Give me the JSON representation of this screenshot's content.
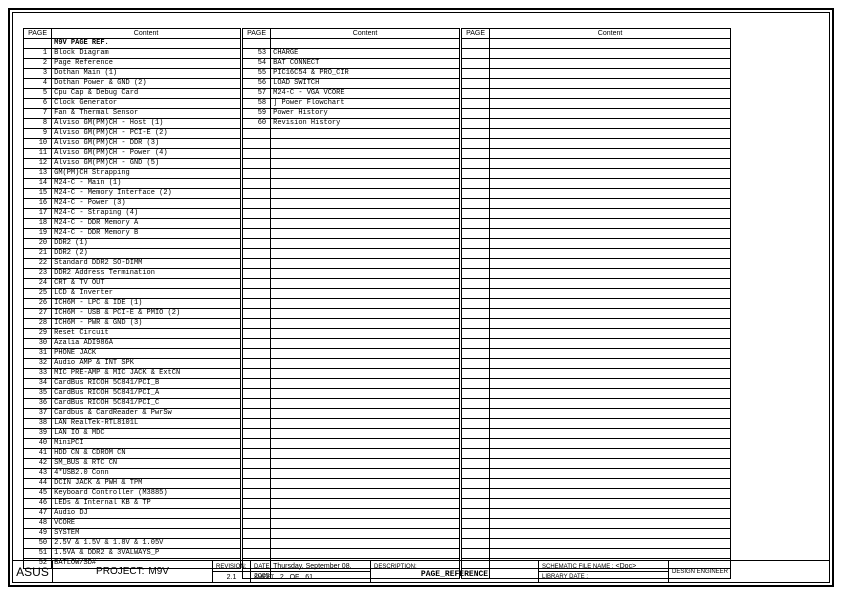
{
  "headers": {
    "page": "PAGE",
    "content": "Content"
  },
  "heading_row": "M9V PAGE REF.",
  "left": [
    {
      "p": "1",
      "c": "Block Diagram"
    },
    {
      "p": "2",
      "c": "Page Reference"
    },
    {
      "p": "3",
      "c": "Dothan Main (1)"
    },
    {
      "p": "4",
      "c": "Dothan Power & GND (2)"
    },
    {
      "p": "5",
      "c": "Cpu Cap & Debug Card"
    },
    {
      "p": "6",
      "c": "Clock Generator"
    },
    {
      "p": "7",
      "c": "Fan & Thermal Sensor"
    },
    {
      "p": "8",
      "c": "Alviso GM(PM)CH - Host (1)"
    },
    {
      "p": "9",
      "c": "Alviso GM(PM)CH - PCI-E (2)"
    },
    {
      "p": "10",
      "c": "Alviso GM(PM)CH - DDR (3)"
    },
    {
      "p": "11",
      "c": "Alviso GM(PM)CH - Power (4)"
    },
    {
      "p": "12",
      "c": "Alviso GM(PM)CH - GND (5)"
    },
    {
      "p": "13",
      "c": "GM(PM)CH Strapping"
    },
    {
      "p": "14",
      "c": "M24-C - Main (1)"
    },
    {
      "p": "15",
      "c": "M24-C - Memory Interface (2)"
    },
    {
      "p": "16",
      "c": "M24-C - Power (3)"
    },
    {
      "p": "17",
      "c": "M24-C - Straping (4)"
    },
    {
      "p": "18",
      "c": "M24-C - DDR Memory A"
    },
    {
      "p": "19",
      "c": "M24-C - DDR Memory B"
    },
    {
      "p": "20",
      "c": "DDR2 (1)"
    },
    {
      "p": "21",
      "c": "DDR2 (2)"
    },
    {
      "p": "22",
      "c": "Standard DDR2 SO-DIMM"
    },
    {
      "p": "23",
      "c": "DDR2 Address Termination"
    },
    {
      "p": "24",
      "c": "CRT & TV OUT"
    },
    {
      "p": "25",
      "c": "LCD & Inverter"
    },
    {
      "p": "26",
      "c": "ICH6M - LPC & IDE (1)"
    },
    {
      "p": "27",
      "c": "ICH6M - USB & PCI-E & PMIO (2)"
    },
    {
      "p": "28",
      "c": "ICH6M - PWR & GND (3)"
    },
    {
      "p": "29",
      "c": "Reset Circuit"
    },
    {
      "p": "30",
      "c": "Azalia ADI986A"
    },
    {
      "p": "31",
      "c": "PHONE JACK"
    },
    {
      "p": "32",
      "c": "Audio AMP & INT SPK"
    },
    {
      "p": "33",
      "c": "MIC PRE-AMP & MIC JACK & ExtCN"
    },
    {
      "p": "34",
      "c": "CardBus RICOH 5C841/PCI_B"
    },
    {
      "p": "35",
      "c": "CardBus RICOH 5C841/PCI_A"
    },
    {
      "p": "36",
      "c": "CardBus RICOH 5C841/PCI_C"
    },
    {
      "p": "37",
      "c": "Cardbus & CardReader & PwrSw"
    },
    {
      "p": "38",
      "c": "LAN RealTek-RTL8101L"
    },
    {
      "p": "39",
      "c": "LAN IO & MDC"
    },
    {
      "p": "40",
      "c": "MiniPCI"
    },
    {
      "p": "41",
      "c": "HDD CN & CDROM CN"
    },
    {
      "p": "42",
      "c": "SM_BUS & RTC CN"
    },
    {
      "p": "43",
      "c": "4*USB2.0 Conn"
    },
    {
      "p": "44",
      "c": "DCIN JACK & PWH & TPM"
    },
    {
      "p": "45",
      "c": "Keyboard Controller (M3885)"
    },
    {
      "p": "46",
      "c": "LEDs & Internal KB & TP"
    },
    {
      "p": "47",
      "c": "Audio DJ"
    },
    {
      "p": "48",
      "c": "VCORE"
    },
    {
      "p": "49",
      "c": "SYSTEM"
    },
    {
      "p": "50",
      "c": "2.5V & 1.5V & 1.8V & 1.05V"
    },
    {
      "p": "51",
      "c": "1.5VA & DDR2 & 3VALWAYS_P"
    },
    {
      "p": "52",
      "c": "BATLOW/SD#"
    }
  ],
  "mid": [
    {
      "p": "53",
      "c": "CHARGE"
    },
    {
      "p": "54",
      "c": "BAT CONNECT"
    },
    {
      "p": "55",
      "c": "PIC16C54 & PRO_CIR"
    },
    {
      "p": "56",
      "c": "LOAD SWITCH"
    },
    {
      "p": "57",
      "c": "M24-C - VGA VCORE"
    },
    {
      "p": "58",
      "c": "]   Power Flowchart"
    },
    {
      "p": "59",
      "c": "Power History"
    },
    {
      "p": "60",
      "c": "Revision History"
    }
  ],
  "mid_blank_rows": 45,
  "right_blank_rows": 54,
  "titleblock": {
    "company": "ASUS",
    "project_label": "PROJECT:",
    "project_value": "M9V",
    "revision_label": "REVISION:",
    "revision_value": "2.1",
    "date_label": "DATE:",
    "date_value": "Thursday, September 08, 2005",
    "sheet_label": "SHEET",
    "sheet_num": "2",
    "sheet_of": "OF",
    "sheet_total": "61",
    "description_label": "DESCRIPTION:",
    "description_value": "PAGE_REFERENCE",
    "schematic_label": "SCHEMATIC FILE NAME :",
    "schematic_value": "<Doc>",
    "library_label": "LIBRARY DATE :",
    "engineer_label": "DESIGN ENGINEER :"
  }
}
